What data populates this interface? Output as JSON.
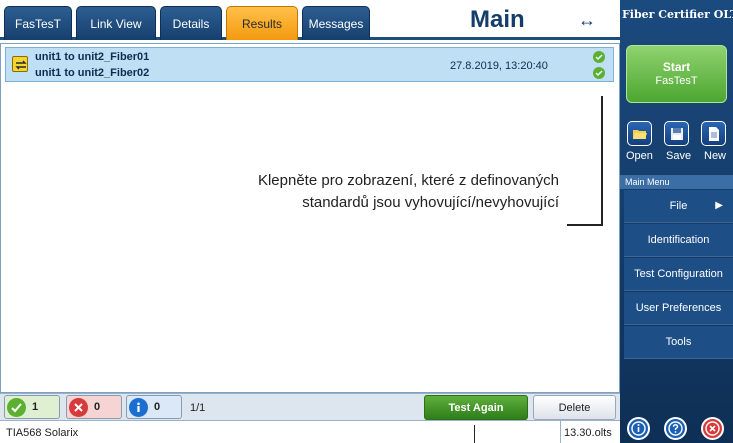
{
  "tabs": [
    {
      "label": "FasTesT",
      "active": false
    },
    {
      "label": "Link View",
      "active": false
    },
    {
      "label": "Details",
      "active": false
    },
    {
      "label": "Results",
      "active": true
    },
    {
      "label": "Messages",
      "active": false
    }
  ],
  "header": {
    "title": "Main",
    "arrow": "↔"
  },
  "sidebar": {
    "app_title": "Fiber Certifier OLTS",
    "start_button": {
      "label": "Start",
      "sublabel": "FasTesT"
    },
    "icon_buttons": [
      {
        "label": "Open",
        "icon": "folder-open-icon"
      },
      {
        "label": "Save",
        "icon": "floppy-disk-icon"
      },
      {
        "label": "New",
        "icon": "new-document-icon"
      }
    ],
    "menu_header": "Main Menu",
    "menu_items": [
      {
        "label": "File",
        "has_submenu": true
      },
      {
        "label": "Identification"
      },
      {
        "label": "Test Configuration"
      },
      {
        "label": "User Preferences"
      },
      {
        "label": "Tools"
      }
    ],
    "bottom_buttons": [
      {
        "icon": "info-icon",
        "color": "#1b5fb5"
      },
      {
        "icon": "help-icon",
        "color": "#1b5fb5"
      },
      {
        "icon": "exit-icon",
        "color": "#d63a3a"
      }
    ]
  },
  "results": {
    "row": {
      "name_1": "unit1 to unit2_Fiber01",
      "name_2": "unit1 to unit2_Fiber02",
      "date": "27.8.2019, 13:20:40",
      "status_1": "pass",
      "status_2": "pass"
    },
    "callout_line_1": "Klepněte pro zobrazení, které z definovaných",
    "callout_line_2": "standardů jsou vyhovující/nevyhovující"
  },
  "status_bar": {
    "pass_count": "1",
    "fail_count": "0",
    "info_count": "0",
    "page": "1/1",
    "test_again": "Test Again",
    "delete": "Delete"
  },
  "footer": {
    "standard": "TIA568 Solarix",
    "version": "13.30.olts"
  },
  "colors": {
    "accent": "#1b4a7e",
    "active_tab": "#f39a10",
    "pass": "#5cb031",
    "fail": "#d63a3a",
    "info": "#1b6fcf"
  }
}
